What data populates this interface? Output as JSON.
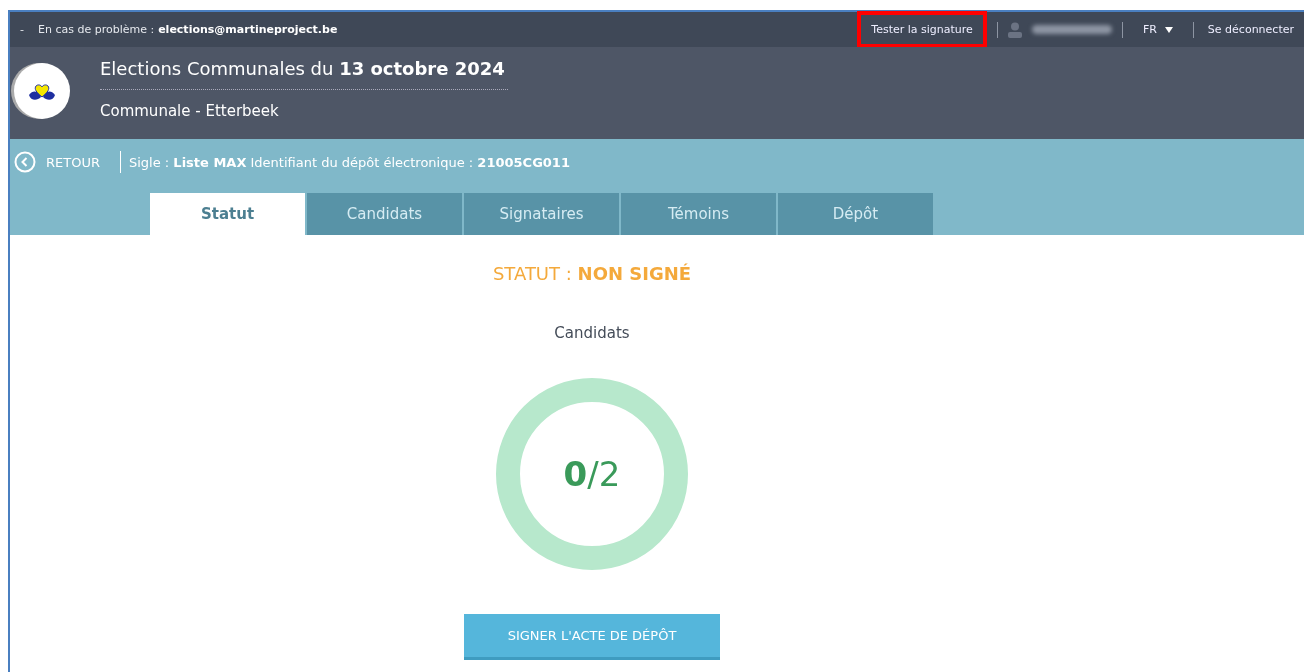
{
  "top_bar": {
    "dash": "-",
    "contact_label": "En cas de problème :",
    "contact_email": "elections@martineproject.be",
    "links": [
      {
        "label": "Tester la signature",
        "highlighted": true
      }
    ],
    "language": "FR",
    "logout": "Se déconnecter"
  },
  "header": {
    "title": "Elections Communales du **13 octobre 2024**",
    "subtitle": "Communale - Etterbeek"
  },
  "nav": {
    "back": "RETOUR",
    "info": "Sigle : **Liste MAX** Identifiant du dépôt électronique : **21005CG011**"
  },
  "tabs": [
    {
      "label": "Statut",
      "selected": true
    },
    {
      "label": "Candidats",
      "selected": false
    },
    {
      "label": "Signataires",
      "selected": false
    },
    {
      "label": "Témoins",
      "selected": false
    },
    {
      "label": "Dépôt",
      "selected": false
    }
  ],
  "status": {
    "label": "STATUT :",
    "value": "NON SIGNÉ"
  },
  "progress": {
    "title": "Candidats",
    "done": "0",
    "total": "/2"
  },
  "action_button": "SIGNER L'ACTE DE DÉPÔT"
}
